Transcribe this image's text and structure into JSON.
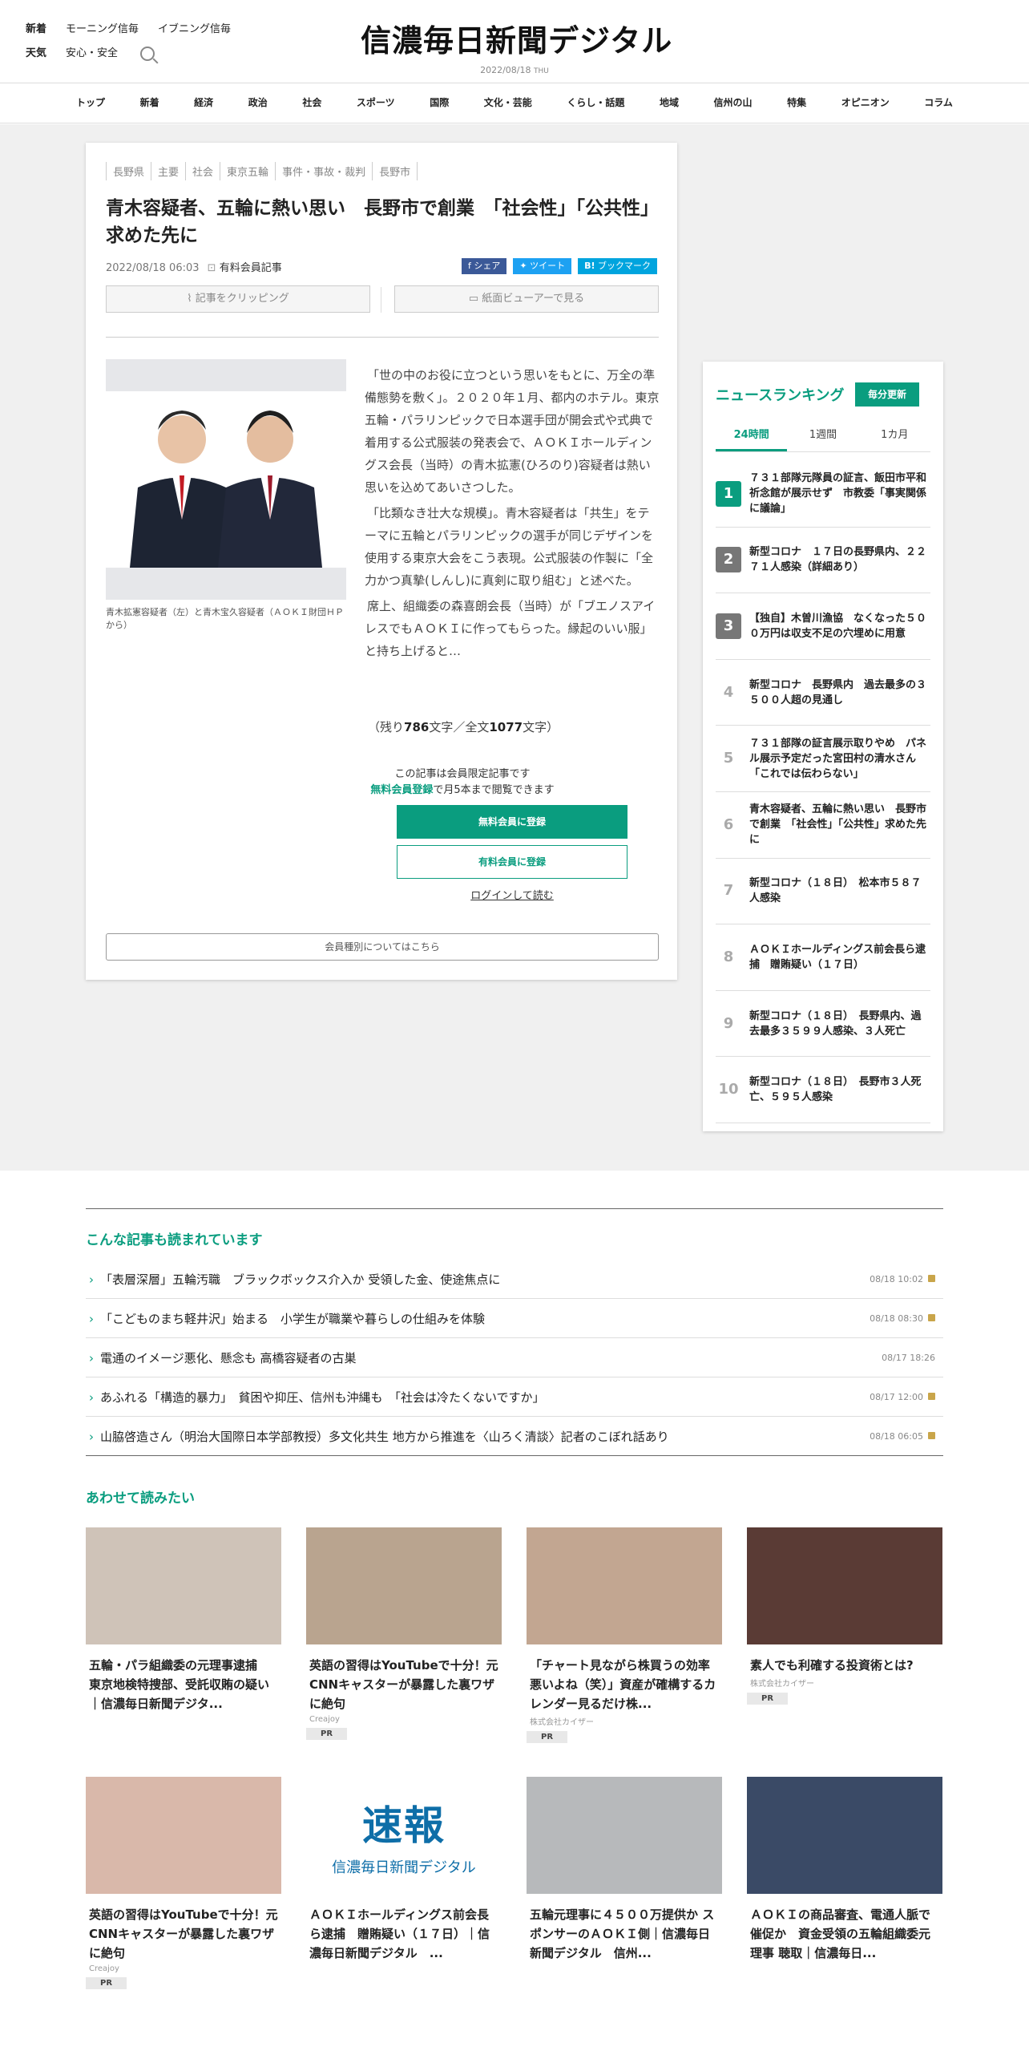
{
  "header": {
    "links_row1": [
      "新着",
      "モーニング信毎",
      "イブニング信毎"
    ],
    "links_row2": [
      "天気",
      "安心・安全"
    ],
    "logo": "信濃毎日新聞デジタル",
    "date": "2022/08/18",
    "weekday": "THU"
  },
  "nav": [
    "トップ",
    "新着",
    "経済",
    "政治",
    "社会",
    "スポーツ",
    "国際",
    "文化・芸能",
    "くらし・話題",
    "地域",
    "信州の山",
    "特集",
    "オピニオン",
    "コラム"
  ],
  "article": {
    "tags": [
      "長野県",
      "主要",
      "社会",
      "東京五輪",
      "事件・事故・裁判",
      "長野市"
    ],
    "headline": "青木容疑者、五輪に熱い思い　長野市で創業　「社会性」「公共性」求めた先に",
    "datetime": "2022/08/18 06:03",
    "member_label": "有料会員記事",
    "share": [
      "シェア",
      "ツイート",
      "ブックマーク"
    ],
    "clip_label": "記事をクリッピング",
    "viewer_label": "紙面ビューアーで見る",
    "caption": "青木拡憲容疑者（左）と青木宝久容疑者（ＡＯＫＩ財団ＨＰから）",
    "paragraphs": [
      "「世の中のお役に立つという思いをもとに、万全の準備態勢を敷く」。２０２０年１月、都内のホテル。東京五輪・パラリンピックで日本選手団が開会式や式典で着用する公式服装の発表会で、ＡＯＫＩホールディングス会長（当時）の青木拡憲(ひろのり)容疑者は熱い思いを込めてあいさつした。",
      "「比類なき壮大な規模」。青木容疑者は「共生」をテーマに五輪とパラリンピックの選手が同じデザインを使用する東京大会をこう表現。公式服装の作製に「全力かつ真摯(しんし)に真剣に取り組む」と述べた。",
      "席上、組織委の森喜朗会長（当時）が「ブエノスアイレスでもＡＯＫＩに作ってもらった。縁起のいい服」と持ち上げると…"
    ],
    "remain_prefix": "（残り",
    "remain_count": "786",
    "remain_mid": "文字／全文",
    "total_count": "1077",
    "remain_suffix": "文字）",
    "limited_note": "この記事は会員限定記事です",
    "free_member_text": "無料会員登録",
    "free_member_tail": "で月5本まで閲覧できます",
    "register_free": "無料会員に登録",
    "register_paid": "有料会員に登録",
    "login": "ログインして読む",
    "membership": "会員種別についてはこちら"
  },
  "ranking": {
    "title": "ニュースランキング",
    "badge": "毎分更新",
    "tabs": [
      "24時間",
      "1週間",
      "1カ月"
    ],
    "items": [
      {
        "rank": "1",
        "text": "７３１部隊元隊員の証言、飯田市平和祈念館が展示せず　市教委「事実関係に議論」"
      },
      {
        "rank": "2",
        "text": "新型コロナ　１７日の長野県内、２２７１人感染（詳細あり）"
      },
      {
        "rank": "3",
        "text": "【独自】木曽川漁協　なくなった５００万円は収支不足の穴埋めに用意"
      },
      {
        "rank": "4",
        "text": "新型コロナ　長野県内　過去最多の３５００人超の見通し"
      },
      {
        "rank": "5",
        "text": "７３１部隊の証言展示取りやめ　パネル展示予定だった宮田村の清水さん「これでは伝わらない」"
      },
      {
        "rank": "6",
        "text": "青木容疑者、五輪に熱い思い　長野市で創業　「社会性」「公共性」求めた先に"
      },
      {
        "rank": "7",
        "text": "新型コロナ（１８日）　松本市５８７人感染"
      },
      {
        "rank": "8",
        "text": "ＡＯＫＩホールディングス前会長ら逮捕　贈賄疑い（１７日）"
      },
      {
        "rank": "9",
        "text": "新型コロナ（１８日）　長野県内、過去最多３５９９人感染、３人死亡"
      },
      {
        "rank": "10",
        "text": "新型コロナ（１８日）　長野市３人死亡、５９５人感染"
      }
    ]
  },
  "also_read": {
    "title": "こんな記事も読まれています",
    "items": [
      {
        "text": "「表層深層」五輪汚職　ブラックボックス介入か 受領した金、使途焦点に",
        "date": "08/18 10:02",
        "locked": true
      },
      {
        "text": "「こどものまち軽井沢」始まる　小学生が職業や暮らしの仕組みを体験",
        "date": "08/18 08:30",
        "locked": true
      },
      {
        "text": "電通のイメージ悪化、懸念も 高橋容疑者の古巣",
        "date": "08/17 18:26",
        "locked": false
      },
      {
        "text": "あふれる「構造的暴力」　貧困や抑圧、信州も沖縄も　「社会は冷たくないですか」",
        "date": "08/17 12:00",
        "locked": true
      },
      {
        "text": "山脇啓造さん（明治大国際日本学部教授）多文化共生 地方から推進を〈山ろく清談〉記者のこぼれ話あり",
        "date": "08/18 06:05",
        "locked": true
      }
    ]
  },
  "recommend": {
    "title": "あわせて読みたい",
    "tiles": [
      {
        "title": "五輪・パラ組織委の元理事逮捕　東京地検特捜部、受託収賄の疑い｜信濃毎日新聞デジタ...",
        "source": "",
        "pr": ""
      },
      {
        "title": "英語の習得はYouTubeで十分！元CNNキャスターが暴露した裏ワザに絶句",
        "source": "Creajoy",
        "pr": "PR"
      },
      {
        "title": "「チャート見ながら株買うの効率悪いよね（笑）」資産が確構するカレンダー見るだけ株...",
        "source": "株式会社カイザー",
        "pr": "PR"
      },
      {
        "title": "素人でも利確する投資術とは?",
        "source": "株式会社カイザー",
        "pr": "PR"
      },
      {
        "title": "英語の習得はYouTubeで十分！元CNNキャスターが暴露した裏ワザに絶句",
        "source": "Creajoy",
        "pr": "PR"
      },
      {
        "title": "ＡＯＫＩホールディングス前会長ら逮捕　贈賄疑い（１７日）｜信濃毎日新聞デジタル　...",
        "source": "",
        "pr": ""
      },
      {
        "title": "五輪元理事に４５００万提供か スポンサーのＡＯＫＩ側｜信濃毎日新聞デジタル　信州...",
        "source": "",
        "pr": ""
      },
      {
        "title": "ＡＯＫＩの商品審査、電通人脈で催促か　資金受領の五輪組織委元理事 聴取｜信濃毎日...",
        "source": "",
        "pr": ""
      }
    ],
    "breaking_title": "速報",
    "breaking_sub": "信濃毎日新聞デジタル"
  },
  "colors": {
    "accent": "#0a9d7f",
    "facebook": "#3b5998",
    "twitter": "#1da1f2",
    "hatena": "#00a4de"
  }
}
